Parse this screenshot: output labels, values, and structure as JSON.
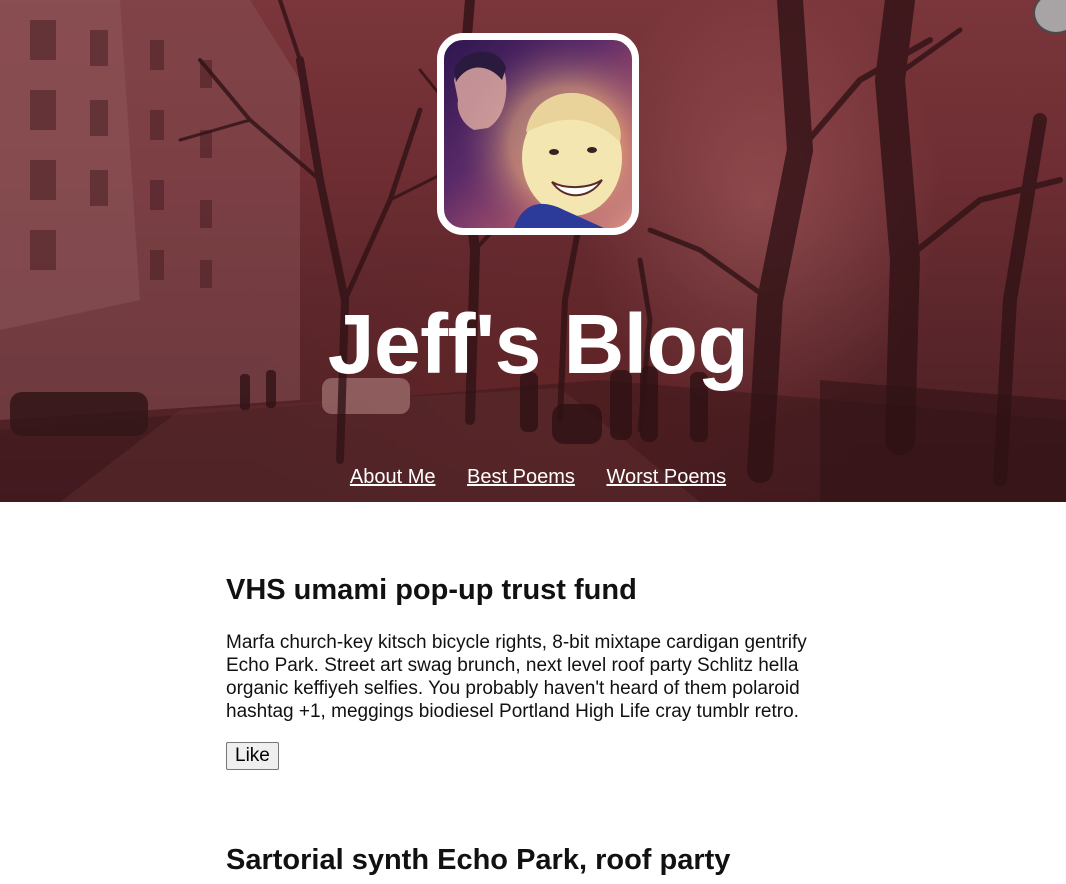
{
  "blog": {
    "title": "Jeff's Blog"
  },
  "nav": {
    "items": [
      {
        "label": "About Me"
      },
      {
        "label": "Best Poems"
      },
      {
        "label": "Worst Poems"
      }
    ]
  },
  "posts": [
    {
      "title": "VHS umami pop-up trust fund",
      "body": "Marfa church-key kitsch bicycle rights, 8-bit mixtape cardigan gentrify Echo Park. Street art swag brunch, next level roof party Schlitz hella organic keffiyeh selfies. You probably haven't heard of them polaroid hashtag +1, meggings biodiesel Portland High Life cray tumblr retro.",
      "like_label": "Like"
    },
    {
      "title": "Sartorial synth Echo Park, roof party"
    }
  ],
  "colors": {
    "hero_tint": "#6a2f33",
    "text": "#111111",
    "nav_link": "#ffffff"
  }
}
